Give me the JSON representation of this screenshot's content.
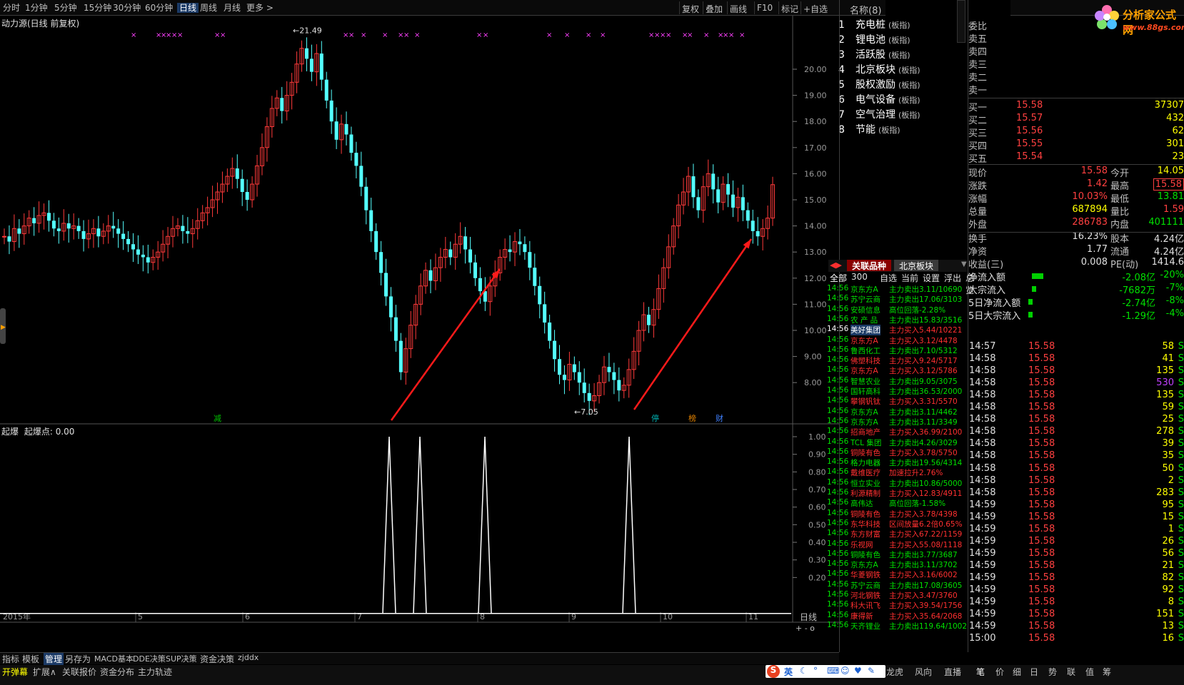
{
  "toolbar": {
    "periods": [
      "分时",
      "1分钟",
      "5分钟",
      "15分钟",
      "30分钟",
      "60分钟",
      "日线",
      "周线",
      "月线",
      "更多 >"
    ],
    "selected": "日线",
    "right_buttons": [
      "复权",
      "叠加",
      "画线",
      "F10",
      "标记",
      "+自选"
    ]
  },
  "chart_title": "动力源(日线 前复权)",
  "price_high_label": "21.49",
  "price_low_label": "7.05",
  "lower_indicator": {
    "name": "起爆",
    "label": "起爆点: 0.00"
  },
  "year_label": "2015年",
  "period_label": "日线",
  "chart_data": {
    "type": "candlestick",
    "y_ticks": [
      "20.00",
      "19.00",
      "18.00",
      "17.00",
      "16.00",
      "15.00",
      "14.00",
      "13.00",
      "12.00",
      "11.00",
      "10.00",
      "9.00",
      "8.00"
    ],
    "x_month_labels": [
      "5",
      "6",
      "7",
      "8",
      "9",
      "10",
      "11"
    ],
    "lower_y_ticks": [
      "1.00",
      "0.90",
      "0.80",
      "0.70",
      "0.60",
      "0.50",
      "0.40",
      "0.30",
      "0.20"
    ],
    "signal_spikes_value": 1.0,
    "badges": [
      "减",
      "停",
      "榜",
      "财"
    ]
  },
  "sector_list": {
    "header": "名称(8)",
    "items": [
      {
        "no": "1",
        "name": "充电桩",
        "tag": "(板指)"
      },
      {
        "no": "2",
        "name": "锂电池",
        "tag": "(板指)"
      },
      {
        "no": "3",
        "name": "活跃股",
        "tag": "(板指)"
      },
      {
        "no": "4",
        "name": "北京板块",
        "tag": "(板指)"
      },
      {
        "no": "5",
        "name": "股权激励",
        "tag": "(板指)"
      },
      {
        "no": "6",
        "name": "电气设备",
        "tag": "(板指)"
      },
      {
        "no": "7",
        "name": "空气治理",
        "tag": "(板指)"
      },
      {
        "no": "8",
        "name": "节能",
        "tag": "(板指)"
      }
    ]
  },
  "logo": {
    "title": "分析家公式网",
    "url": "www.88gs.com"
  },
  "order_book": {
    "sell": [
      "委比",
      "卖五",
      "卖四",
      "卖三",
      "卖二",
      "卖一"
    ],
    "buy": [
      {
        "label": "买一",
        "price": "15.58",
        "vol": "37307"
      },
      {
        "label": "买二",
        "price": "15.57",
        "vol": "432"
      },
      {
        "label": "买三",
        "price": "15.56",
        "vol": "62"
      },
      {
        "label": "买四",
        "price": "15.55",
        "vol": "301"
      },
      {
        "label": "买五",
        "price": "15.54",
        "vol": "23"
      }
    ]
  },
  "quote": [
    {
      "k1": "现价",
      "v1": "15.58",
      "k2": "今开",
      "v2": "14.05"
    },
    {
      "k1": "涨跌",
      "v1": "1.42",
      "k2": "最高",
      "v2": "15.58"
    },
    {
      "k1": "涨幅",
      "v1": "10.03%",
      "k2": "最低",
      "v2": "13.81"
    },
    {
      "k1": "总量",
      "v1": "687894",
      "k2": "量比",
      "v2": "1.59"
    },
    {
      "k1": "外盘",
      "v1": "286783",
      "k2": "内盘",
      "v2": "401111"
    },
    {
      "k1": "换手",
      "v1": "16.23%",
      "k2": "股本",
      "v2": "4.24亿"
    },
    {
      "k1": "净资",
      "v1": "1.77",
      "k2": "流通",
      "v2": "4.24亿"
    },
    {
      "k1": "收益(三)",
      "v1": "0.008",
      "k2": "PE(动)",
      "v2": "1414.6"
    }
  ],
  "fund_flow": [
    {
      "label": "净流入额",
      "value": "-2.08亿",
      "pct": "-20%",
      "level": 0.2
    },
    {
      "label": "大宗流入",
      "value": "-7682万",
      "pct": "-7%",
      "level": 0.07
    },
    {
      "label": "5日净流入额",
      "value": "-2.74亿",
      "pct": "-8%",
      "level": 0.08
    },
    {
      "label": "5日大宗流入",
      "value": "-1.29亿",
      "pct": "-4%",
      "level": 0.04
    }
  ],
  "tabs": [
    "关联品种",
    "北京板块"
  ],
  "filter": [
    "全部",
    "300",
    "自选",
    "当前",
    "设置",
    "浮出",
    "总览"
  ],
  "ticker": [
    {
      "time": "14:56",
      "name": "京东方A",
      "act": "主力卖出",
      "val": "3.11/10690",
      "c": "g"
    },
    {
      "time": "14:56",
      "name": "苏宁云商",
      "act": "主力卖出",
      "val": "17.06/3103",
      "c": "g"
    },
    {
      "time": "14:56",
      "name": "安硕信息",
      "act": "高位回落",
      "val": "-2.28%",
      "c": "g"
    },
    {
      "time": "14:56",
      "name": "农 产 品",
      "act": "主力卖出",
      "val": "15.83/3516",
      "c": "g"
    },
    {
      "time": "14:56",
      "name": "美好集团",
      "act": "主力买入",
      "val": "5.44/10221",
      "c": "r"
    },
    {
      "time": "14:56",
      "name": "京东方A",
      "act": "主力买入",
      "val": "3.12/4478",
      "c": "r"
    },
    {
      "time": "14:56",
      "name": "鲁西化工",
      "act": "主力卖出",
      "val": "7.10/5312",
      "c": "g"
    },
    {
      "time": "14:56",
      "name": "佛塑科技",
      "act": "主力买入",
      "val": "9.24/5717",
      "c": "r"
    },
    {
      "time": "14:56",
      "name": "京东方A",
      "act": "主力买入",
      "val": "3.12/5786",
      "c": "r"
    },
    {
      "time": "14:56",
      "name": "智慧农业",
      "act": "主力卖出",
      "val": "9.05/3075",
      "c": "g"
    },
    {
      "time": "14:56",
      "name": "国轩高科",
      "act": "主力卖出",
      "val": "36.53/2000",
      "c": "g"
    },
    {
      "time": "14:56",
      "name": "攀钢钒钛",
      "act": "主力买入",
      "val": "3.31/5570",
      "c": "r"
    },
    {
      "time": "14:56",
      "name": "京东方A",
      "act": "主力卖出",
      "val": "3.11/4462",
      "c": "g"
    },
    {
      "time": "14:56",
      "name": "京东方A",
      "act": "主力卖出",
      "val": "3.11/3349",
      "c": "g"
    },
    {
      "time": "14:56",
      "name": "招商地产",
      "act": "主力买入",
      "val": "36.99/2100",
      "c": "r"
    },
    {
      "time": "14:56",
      "name": "TCL 集团",
      "act": "主力卖出",
      "val": "4.26/3029",
      "c": "g"
    },
    {
      "time": "14:56",
      "name": "铜陵有色",
      "act": "主力买入",
      "val": "3.78/5750",
      "c": "r"
    },
    {
      "time": "14:56",
      "name": "格力电器",
      "act": "主力卖出",
      "val": "19.56/4314",
      "c": "g"
    },
    {
      "time": "14:56",
      "name": "戴维医疗",
      "act": "加速拉升",
      "val": "2.76%",
      "c": "r"
    },
    {
      "time": "14:56",
      "name": "恒立实业",
      "act": "主力卖出",
      "val": "10.86/5000",
      "c": "g"
    },
    {
      "time": "14:56",
      "name": "利源精制",
      "act": "主力买入",
      "val": "12.83/4911",
      "c": "r"
    },
    {
      "time": "14:56",
      "name": "高伟达",
      "act": "高位回落",
      "val": "-1.58%",
      "c": "g"
    },
    {
      "time": "14:56",
      "name": "铜陵有色",
      "act": "主力买入",
      "val": "3.78/4398",
      "c": "r"
    },
    {
      "time": "14:56",
      "name": "东华科技",
      "act": "区间放量",
      "val": "6.2倍0.65%",
      "c": "r"
    },
    {
      "time": "14:56",
      "name": "东方财富",
      "act": "主力买入",
      "val": "67.22/1159",
      "c": "r"
    },
    {
      "time": "14:56",
      "name": "乐视网",
      "act": "主力买入",
      "val": "55.08/1118",
      "c": "r"
    },
    {
      "time": "14:56",
      "name": "铜陵有色",
      "act": "主力卖出",
      "val": "3.77/3687",
      "c": "g"
    },
    {
      "time": "14:56",
      "name": "京东方A",
      "act": "主力卖出",
      "val": "3.11/3702",
      "c": "g"
    },
    {
      "time": "14:56",
      "name": "华菱钢铁",
      "act": "主力买入",
      "val": "3.16/6002",
      "c": "r"
    },
    {
      "time": "14:56",
      "name": "苏宁云商",
      "act": "主力卖出",
      "val": "17.08/3605",
      "c": "g"
    },
    {
      "time": "14:56",
      "name": "河北钢铁",
      "act": "主力买入",
      "val": "3.47/3760",
      "c": "r"
    },
    {
      "time": "14:56",
      "name": "科大讯飞",
      "act": "主力买入",
      "val": "39.54/1756",
      "c": "r"
    },
    {
      "time": "14:56",
      "name": "康得新",
      "act": "主力买入",
      "val": "35.64/2068",
      "c": "r"
    },
    {
      "time": "14:56",
      "name": "天齐锂业",
      "act": "主力卖出",
      "val": "119.64/1002",
      "c": "g"
    }
  ],
  "deals": [
    {
      "time": "14:57",
      "price": "15.58",
      "vol": "58",
      "s": "S"
    },
    {
      "time": "14:58",
      "price": "15.58",
      "vol": "41",
      "s": "S"
    },
    {
      "time": "14:58",
      "price": "15.58",
      "vol": "135",
      "s": "S"
    },
    {
      "time": "14:58",
      "price": "15.58",
      "vol": "530",
      "s": "S",
      "hi": true
    },
    {
      "time": "14:58",
      "price": "15.58",
      "vol": "135",
      "s": "S"
    },
    {
      "time": "14:58",
      "price": "15.58",
      "vol": "59",
      "s": "S"
    },
    {
      "time": "14:58",
      "price": "15.58",
      "vol": "25",
      "s": "S"
    },
    {
      "time": "14:58",
      "price": "15.58",
      "vol": "278",
      "s": "S"
    },
    {
      "time": "14:58",
      "price": "15.58",
      "vol": "39",
      "s": "S"
    },
    {
      "time": "14:58",
      "price": "15.58",
      "vol": "35",
      "s": "S"
    },
    {
      "time": "14:58",
      "price": "15.58",
      "vol": "50",
      "s": "S"
    },
    {
      "time": "14:58",
      "price": "15.58",
      "vol": "2",
      "s": "S"
    },
    {
      "time": "14:58",
      "price": "15.58",
      "vol": "283",
      "s": "S"
    },
    {
      "time": "14:59",
      "price": "15.58",
      "vol": "95",
      "s": "S"
    },
    {
      "time": "14:59",
      "price": "15.58",
      "vol": "15",
      "s": "S"
    },
    {
      "time": "14:59",
      "price": "15.58",
      "vol": "1",
      "s": "S"
    },
    {
      "time": "14:59",
      "price": "15.58",
      "vol": "26",
      "s": "S"
    },
    {
      "time": "14:59",
      "price": "15.58",
      "vol": "56",
      "s": "S"
    },
    {
      "time": "14:59",
      "price": "15.58",
      "vol": "21",
      "s": "S"
    },
    {
      "time": "14:59",
      "price": "15.58",
      "vol": "82",
      "s": "S"
    },
    {
      "time": "14:59",
      "price": "15.58",
      "vol": "92",
      "s": "S"
    },
    {
      "time": "14:59",
      "price": "15.58",
      "vol": "8",
      "s": "S"
    },
    {
      "time": "14:59",
      "price": "15.58",
      "vol": "151",
      "s": "S"
    },
    {
      "time": "14:59",
      "price": "15.58",
      "vol": "13",
      "s": "S"
    },
    {
      "time": "15:00",
      "price": "15.58",
      "vol": "16",
      "s": "S"
    }
  ],
  "bottom_tabs": [
    "指标",
    "模板",
    "管理",
    "另存为",
    "MACD基本",
    "DDE决策",
    "SUP决策",
    "资金决策",
    "zjddx"
  ],
  "bottom_tabs2": [
    "开弹幕",
    "扩展∧",
    "关联报价",
    "资金分布",
    "主力轨迹"
  ],
  "bottom_right": [
    "龙虎",
    "风向",
    "直播",
    "笔",
    "价",
    "细",
    "日",
    "势",
    "联",
    "值",
    "筹"
  ],
  "ime": "英"
}
